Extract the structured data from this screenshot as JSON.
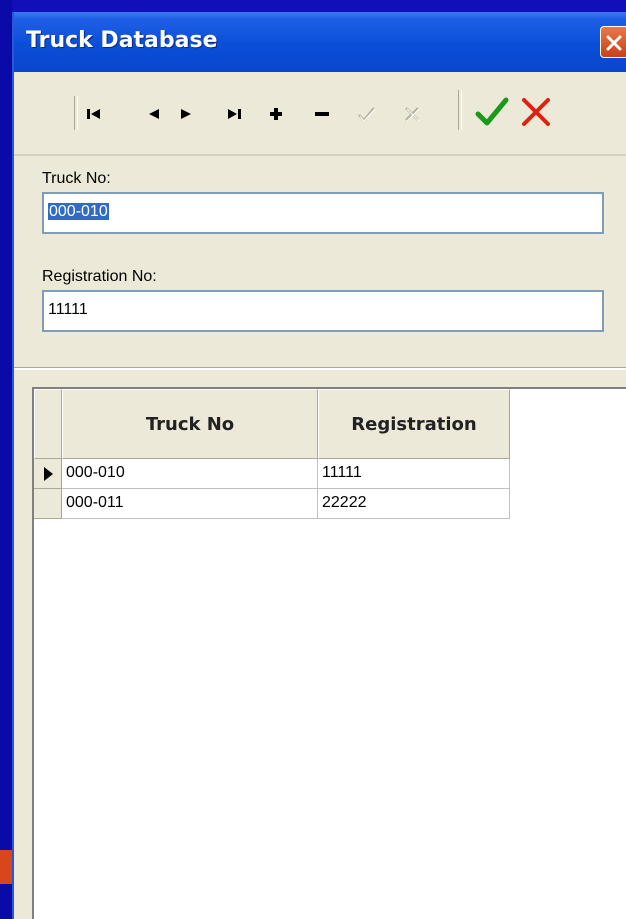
{
  "window": {
    "title": "Truck Database"
  },
  "toolbar": {
    "buttons": [
      {
        "name": "first-record",
        "icon": "first-record-icon",
        "enabled": true
      },
      {
        "name": "prior-record",
        "icon": "prior-record-icon",
        "enabled": true
      },
      {
        "name": "next-record",
        "icon": "next-record-icon",
        "enabled": true
      },
      {
        "name": "last-record",
        "icon": "last-record-icon",
        "enabled": true
      },
      {
        "name": "insert-record",
        "icon": "plus-icon",
        "enabled": true
      },
      {
        "name": "delete-record",
        "icon": "minus-icon",
        "enabled": true
      },
      {
        "name": "post-edit",
        "icon": "check-icon",
        "enabled": false
      },
      {
        "name": "cancel-edit",
        "icon": "x-icon",
        "enabled": false
      },
      {
        "name": "ok",
        "icon": "green-check-icon",
        "enabled": true,
        "color": "#1a9a1a"
      },
      {
        "name": "cancel",
        "icon": "red-x-icon",
        "enabled": true,
        "color": "#e02010"
      }
    ]
  },
  "form": {
    "truck_no_label": "Truck No:",
    "truck_no_value": "000-010",
    "registration_label": "Registration No:",
    "registration_value": "11111"
  },
  "grid": {
    "columns": [
      "Truck No",
      "Registration"
    ],
    "rows": [
      {
        "truck_no": "000-010",
        "registration": "11111",
        "current": true
      },
      {
        "truck_no": "000-011",
        "registration": "22222",
        "current": false
      }
    ]
  },
  "colors": {
    "titlebar": "#0a4ed8",
    "window_face": "#ece9d8",
    "selection": "#316ac5",
    "desktop": "#1010b8"
  }
}
